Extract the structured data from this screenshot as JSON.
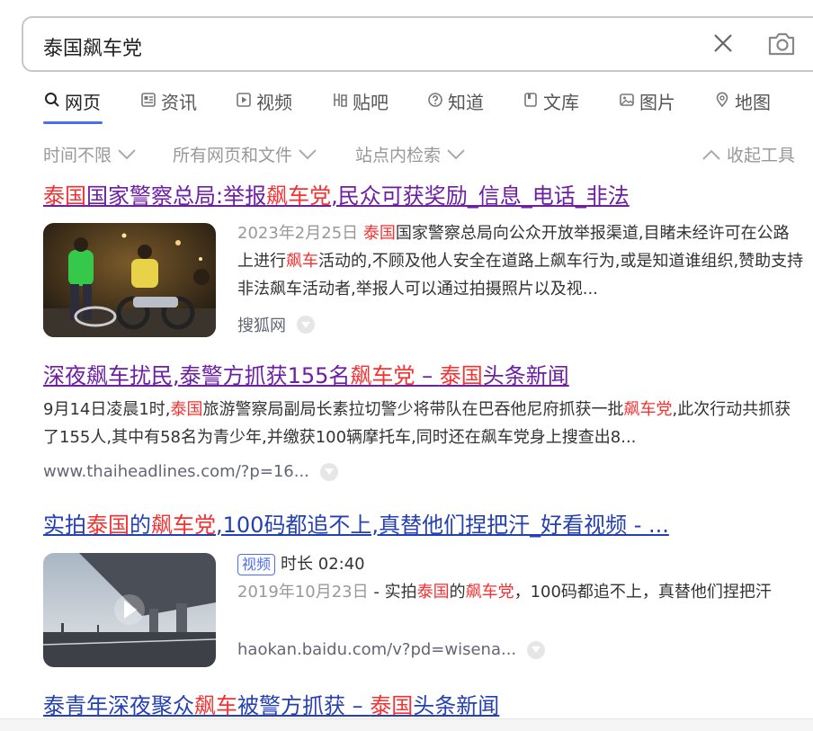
{
  "search": {
    "query": "泰国飙车党"
  },
  "tabs": [
    {
      "label": "网页",
      "icon": "search-icon"
    },
    {
      "label": "资讯",
      "icon": "news-icon"
    },
    {
      "label": "视频",
      "icon": "video-icon"
    },
    {
      "label": "贴吧",
      "icon": "tieba-icon"
    },
    {
      "label": "知道",
      "icon": "question-icon"
    },
    {
      "label": "文库",
      "icon": "document-icon"
    },
    {
      "label": "图片",
      "icon": "image-icon"
    },
    {
      "label": "地图",
      "icon": "map-pin-icon"
    }
  ],
  "filters": {
    "time": "时间不限",
    "filetype": "所有网页和文件",
    "site": "站点内检索",
    "collapse": "收起工具"
  },
  "results": [
    {
      "title": [
        "泰国",
        "国家警察总局:举报",
        "飙车党",
        ",民众可获奖励_信息_电话_非法"
      ],
      "date": "2023年2月25日",
      "snippet": [
        "泰国",
        "国家警察总局向公众开放举报渠道,目睹未经许可在公路上进行",
        "飙车",
        "活动的,不顾及他人安全在道路上飙车行为,或是知道谁组织,赞助支持非法飙车活动者,举报人可以通过拍摄照片以及视..."
      ],
      "source": "搜狐网"
    },
    {
      "title": [
        "深夜飙车扰民,泰警方抓获155名",
        "飙车党",
        " – ",
        "泰国",
        "头条新闻"
      ],
      "snippet": [
        "9月14日凌晨1时,",
        "泰国",
        "旅游警察局副局长素拉切警少将带队在巴吞他尼府抓获一批",
        "飙车党",
        ",此次行动共抓获了155人,其中有58名为青少年,并缴获100辆摩托车,同时还在飙车党身上搜查出8..."
      ],
      "source": "www.thaiheadlines.com/?p=16..."
    },
    {
      "title": [
        "实拍",
        "泰国",
        "的",
        "飙车党",
        ",100码都追不上,真替他们捏把汗_好看视频 - ..."
      ],
      "badge": "视频",
      "duration": "时长 02:40",
      "date": "2019年10月23日",
      "snippet": [
        " - 实拍",
        "泰国",
        "的",
        "飙车党",
        "，100码都追不上，真替他们捏把汗"
      ],
      "source": "haokan.baidu.com/v?pd=wisena..."
    },
    {
      "title": [
        "泰青年深夜聚众",
        "飙车",
        "被警方抓获 – ",
        "泰国",
        "头条新闻"
      ]
    }
  ],
  "colors": {
    "accent": "#4e6ef2",
    "highlight": "#f73131",
    "visited": "#6d1ea3",
    "link": "#2440b3"
  }
}
